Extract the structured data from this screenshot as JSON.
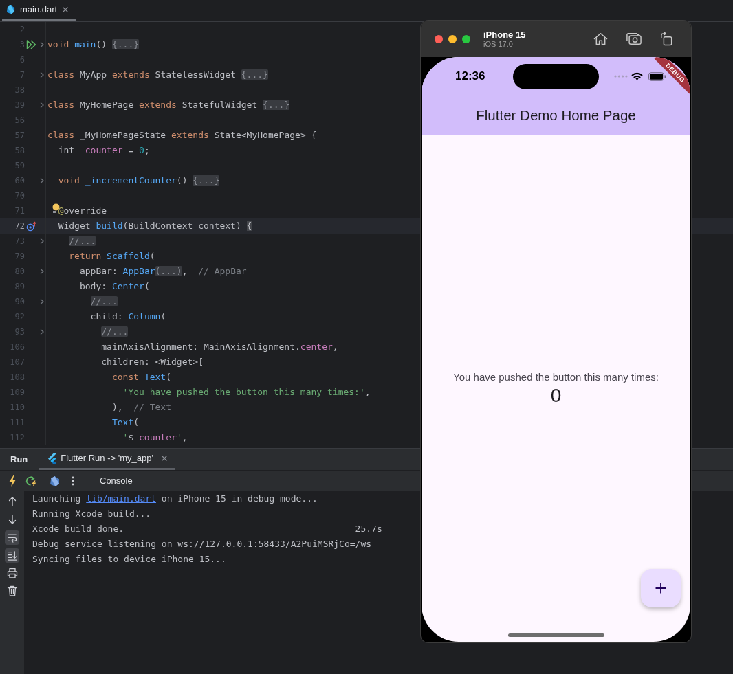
{
  "editor": {
    "tabs": [
      {
        "label": "main.dart",
        "selected": true
      }
    ],
    "lines": [
      {
        "number": "2",
        "kind": "code",
        "current": false,
        "fold": false
      },
      {
        "number": "3",
        "kind": "run",
        "current": false,
        "fold": true,
        "tokens": [
          {
            "text": "void ",
            "kind": "keyword"
          },
          {
            "text": "main",
            "kind": "call"
          },
          {
            "text": "() ",
            "kind": "plain"
          },
          {
            "text": "{...}",
            "kind": "folded"
          }
        ]
      },
      {
        "number": "6",
        "kind": "code",
        "current": false,
        "fold": false
      },
      {
        "number": "7",
        "kind": "code",
        "current": false,
        "fold": true,
        "tokens": [
          {
            "text": "class ",
            "kind": "keyword"
          },
          {
            "text": "MyApp ",
            "kind": "plain"
          },
          {
            "text": "extends ",
            "kind": "keyword"
          },
          {
            "text": "StatelessWidget ",
            "kind": "plain"
          },
          {
            "text": "{...}",
            "kind": "folded"
          }
        ]
      },
      {
        "number": "38",
        "kind": "code",
        "current": false,
        "fold": false
      },
      {
        "number": "39",
        "kind": "code",
        "current": false,
        "fold": true,
        "tokens": [
          {
            "text": "class ",
            "kind": "keyword"
          },
          {
            "text": "MyHomePage ",
            "kind": "plain"
          },
          {
            "text": "extends ",
            "kind": "keyword"
          },
          {
            "text": "StatefulWidget ",
            "kind": "plain"
          },
          {
            "text": "{...}",
            "kind": "folded"
          }
        ]
      },
      {
        "number": "56",
        "kind": "code",
        "current": false,
        "fold": false
      },
      {
        "number": "57",
        "kind": "code",
        "current": false,
        "fold": false,
        "tokens": [
          {
            "text": "class ",
            "kind": "keyword"
          },
          {
            "text": "_MyHomePageState ",
            "kind": "plain"
          },
          {
            "text": "extends ",
            "kind": "keyword"
          },
          {
            "text": "State<MyHomePage> {",
            "kind": "plain"
          }
        ]
      },
      {
        "number": "58",
        "kind": "code",
        "current": false,
        "fold": false,
        "tokens": [
          {
            "text": "  int ",
            "kind": "plain"
          },
          {
            "text": "_counter",
            "kind": "field"
          },
          {
            "text": " = ",
            "kind": "plain"
          },
          {
            "text": "0",
            "kind": "number"
          },
          {
            "text": ";",
            "kind": "plain"
          }
        ]
      },
      {
        "number": "59",
        "kind": "code",
        "current": false,
        "fold": false
      },
      {
        "number": "60",
        "kind": "code",
        "current": false,
        "fold": true,
        "tokens": [
          {
            "text": "  void ",
            "kind": "keyword"
          },
          {
            "text": "_incrementCounter",
            "kind": "call"
          },
          {
            "text": "() ",
            "kind": "plain"
          },
          {
            "text": "{...}",
            "kind": "folded"
          }
        ]
      },
      {
        "number": "70",
        "kind": "code",
        "current": false,
        "fold": false
      },
      {
        "number": "71",
        "kind": "bulb",
        "current": false,
        "fold": false,
        "tokens": [
          {
            "text": "  @",
            "kind": "annotation"
          },
          {
            "text": "override",
            "kind": "plain"
          }
        ]
      },
      {
        "number": "72",
        "kind": "override",
        "current": true,
        "fold": false,
        "tokens": [
          {
            "text": "  Widget ",
            "kind": "plain"
          },
          {
            "text": "build",
            "kind": "call"
          },
          {
            "text": "(BuildContext context) ",
            "kind": "plain"
          },
          {
            "text": "{",
            "kind": "brace"
          }
        ]
      },
      {
        "number": "73",
        "kind": "code",
        "current": false,
        "fold": true,
        "tokens": [
          {
            "text": "    //...",
            "kind": "folded"
          }
        ]
      },
      {
        "number": "79",
        "kind": "code",
        "current": false,
        "fold": false,
        "tokens": [
          {
            "text": "    return ",
            "kind": "keyword"
          },
          {
            "text": "Scaffold",
            "kind": "call"
          },
          {
            "text": "(",
            "kind": "plain"
          }
        ]
      },
      {
        "number": "80",
        "kind": "code",
        "current": false,
        "fold": true,
        "tokens": [
          {
            "text": "      appBar: ",
            "kind": "plain"
          },
          {
            "text": "AppBar",
            "kind": "call"
          },
          {
            "text": "(...)",
            "kind": "folded"
          },
          {
            "text": ",  ",
            "kind": "plain"
          },
          {
            "text": "// AppBar",
            "kind": "comment"
          }
        ]
      },
      {
        "number": "89",
        "kind": "code",
        "current": false,
        "fold": false,
        "tokens": [
          {
            "text": "      body: ",
            "kind": "plain"
          },
          {
            "text": "Center",
            "kind": "call"
          },
          {
            "text": "(",
            "kind": "plain"
          }
        ]
      },
      {
        "number": "90",
        "kind": "code",
        "current": false,
        "fold": true,
        "tokens": [
          {
            "text": "        //...",
            "kind": "folded"
          }
        ]
      },
      {
        "number": "92",
        "kind": "code",
        "current": false,
        "fold": false,
        "tokens": [
          {
            "text": "        child: ",
            "kind": "plain"
          },
          {
            "text": "Column",
            "kind": "call"
          },
          {
            "text": "(",
            "kind": "plain"
          }
        ]
      },
      {
        "number": "93",
        "kind": "code",
        "current": false,
        "fold": true,
        "tokens": [
          {
            "text": "          //...",
            "kind": "folded"
          }
        ]
      },
      {
        "number": "106",
        "kind": "code",
        "current": false,
        "fold": false,
        "tokens": [
          {
            "text": "          mainAxisAlignment: MainAxisAlignment.",
            "kind": "plain"
          },
          {
            "text": "center",
            "kind": "field"
          },
          {
            "text": ",",
            "kind": "plain"
          }
        ]
      },
      {
        "number": "107",
        "kind": "code",
        "current": false,
        "fold": false,
        "tokens": [
          {
            "text": "          children: <Widget>[",
            "kind": "plain"
          }
        ]
      },
      {
        "number": "108",
        "kind": "code",
        "current": false,
        "fold": false,
        "tokens": [
          {
            "text": "            const ",
            "kind": "keyword"
          },
          {
            "text": "Text",
            "kind": "call"
          },
          {
            "text": "(",
            "kind": "plain"
          }
        ]
      },
      {
        "number": "109",
        "kind": "code",
        "current": false,
        "fold": false,
        "tokens": [
          {
            "text": "              'You have pushed the button this many times:'",
            "kind": "string"
          },
          {
            "text": ",",
            "kind": "plain"
          }
        ]
      },
      {
        "number": "110",
        "kind": "code",
        "current": false,
        "fold": false,
        "tokens": [
          {
            "text": "            ),  ",
            "kind": "plain"
          },
          {
            "text": "// Text",
            "kind": "comment"
          }
        ]
      },
      {
        "number": "111",
        "kind": "code",
        "current": false,
        "fold": false,
        "tokens": [
          {
            "text": "            Text",
            "kind": "call"
          },
          {
            "text": "(",
            "kind": "plain"
          }
        ]
      },
      {
        "number": "112",
        "kind": "code",
        "current": false,
        "fold": false,
        "tokens": [
          {
            "text": "              '",
            "kind": "string"
          },
          {
            "text": "$",
            "kind": "plain"
          },
          {
            "text": "_counter",
            "kind": "field"
          },
          {
            "text": "'",
            "kind": "string"
          },
          {
            "text": ",",
            "kind": "plain"
          }
        ]
      }
    ]
  },
  "run_panel": {
    "title": "Run",
    "tabs": [
      {
        "label": "Flutter Run -> 'my_app'",
        "selected": true
      }
    ],
    "console_tab": "Console",
    "side_tools": [
      {
        "kind": "up",
        "on": false
      },
      {
        "kind": "down",
        "on": false
      },
      {
        "kind": "wrap",
        "on": true
      },
      {
        "kind": "scroll_end",
        "on": true
      },
      {
        "kind": "print",
        "on": false
      },
      {
        "kind": "delete",
        "on": false
      }
    ],
    "console": [
      {
        "parts": [
          {
            "text": "Launching ",
            "kind": "text"
          },
          {
            "text": "lib/main.dart",
            "kind": "link"
          },
          {
            "text": " on iPhone 15 in debug mode...",
            "kind": "text"
          }
        ]
      },
      {
        "parts": [
          {
            "text": "Running Xcode build...",
            "kind": "text"
          }
        ]
      },
      {
        "parts": [
          {
            "text": "Xcode build done.",
            "kind": "text"
          }
        ],
        "duration": "25.7s"
      },
      {
        "parts": [
          {
            "text": "Debug service listening on ws://127.0.0.1:58433/A2PuiMSRjCo=/ws",
            "kind": "text"
          }
        ]
      },
      {
        "parts": [
          {
            "text": "Syncing files to device iPhone 15...",
            "kind": "text"
          }
        ]
      }
    ]
  },
  "simulator": {
    "device": "iPhone 15",
    "os": "iOS 17.0",
    "app": {
      "status_time": "12:36",
      "debug_banner": "DEBUG",
      "title": "Flutter Demo Home Page",
      "message": "You have pushed the button this many times:",
      "counter": "0"
    }
  }
}
